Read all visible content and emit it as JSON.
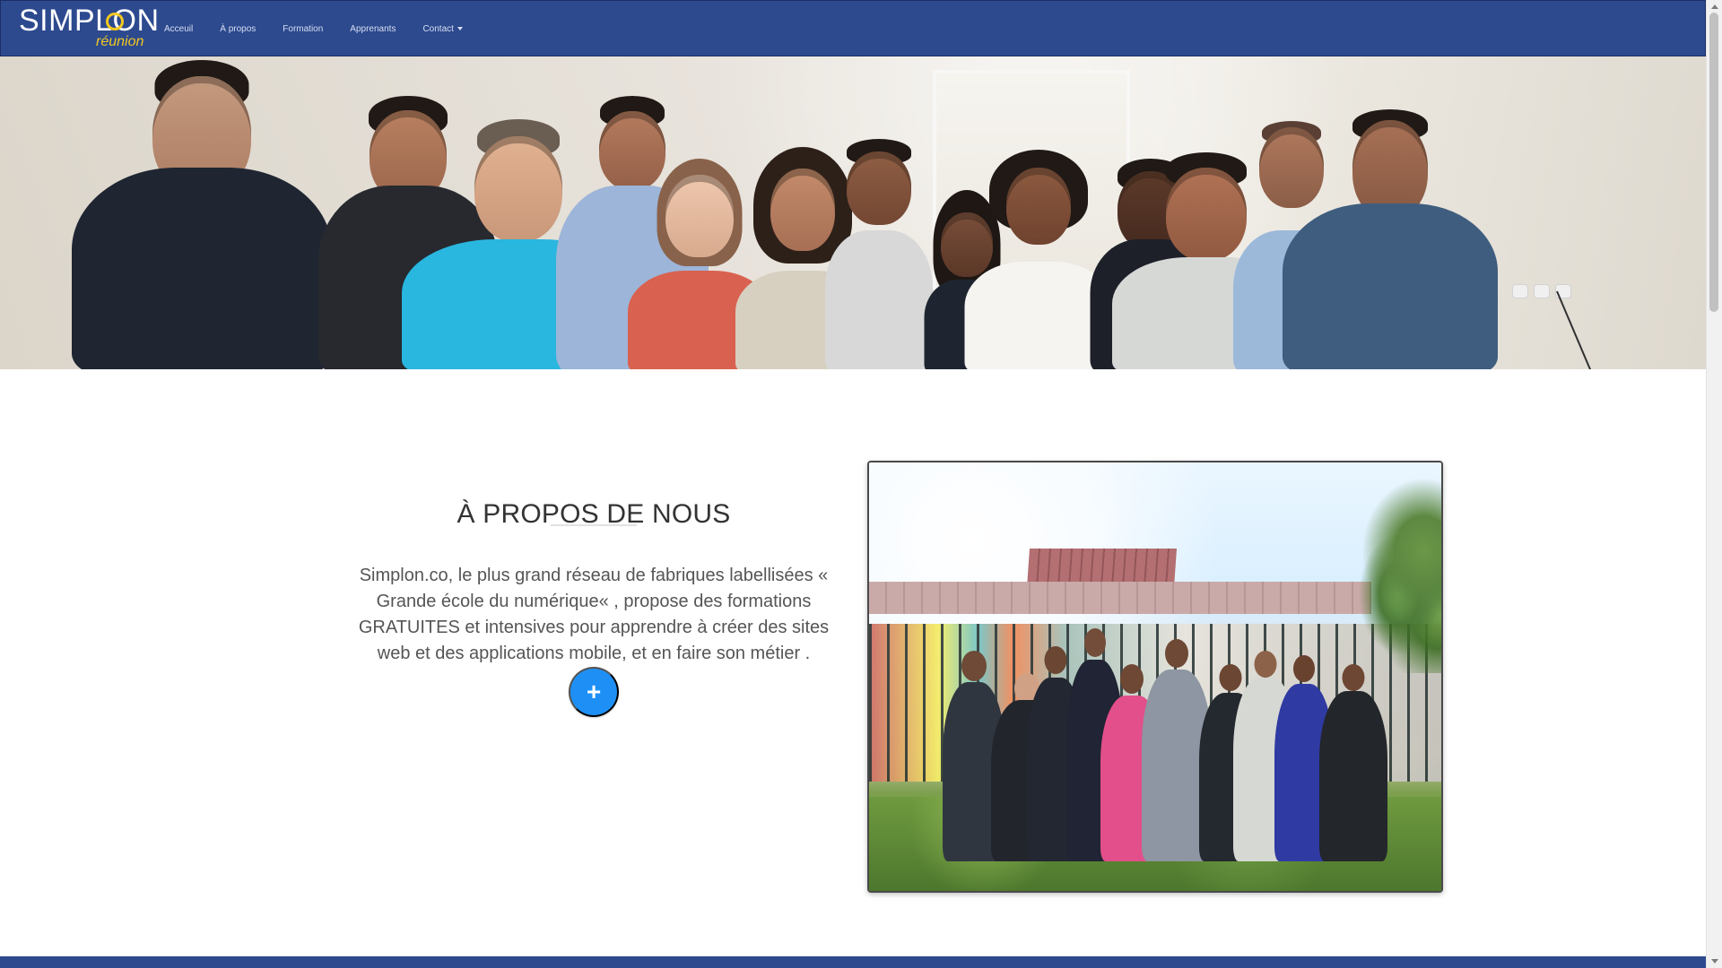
{
  "window": {
    "title": ""
  },
  "brand": {
    "name": "SIMPLON",
    "subtitle": "réunion",
    "accent_color": "#f2c81f",
    "nav_color": "#2d4a8f"
  },
  "nav": {
    "items": [
      {
        "label": "Acceuil"
      },
      {
        "label": "À propos"
      },
      {
        "label": "Formation"
      },
      {
        "label": "Apprenants"
      },
      {
        "label": "Contact"
      }
    ]
  },
  "hero": {
    "image_type": "group-photo"
  },
  "about": {
    "title": "À PROPOS DE NOUS",
    "text": "Simplon.co, le plus grand réseau de fabriques labellisées « Grande école du numérique« , propose des formations GRATUITES et intensives pour apprendre à créer des sites web et des applications mobile, et en faire son métier .",
    "button_symbol": "+",
    "button_color": "#1e90f5"
  },
  "photo": {
    "image_type": "outdoor-group-photo"
  }
}
